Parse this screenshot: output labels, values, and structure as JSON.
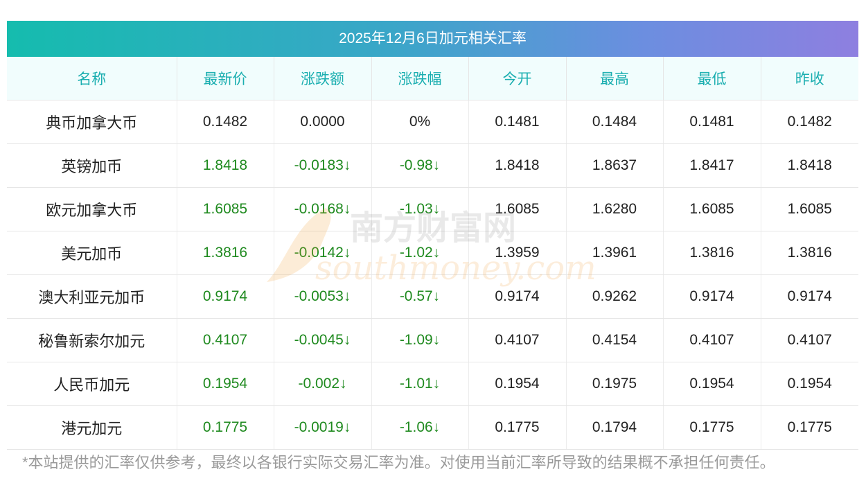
{
  "title": "2025年12月6日加元相关汇率",
  "columns": [
    "名称",
    "最新价",
    "涨跌额",
    "涨跌幅",
    "今开",
    "最高",
    "最低",
    "昨收"
  ],
  "rows": [
    {
      "name": "典币加拿大币",
      "latest": "0.1482",
      "change": "0.0000",
      "pct": "0%",
      "open": "0.1481",
      "high": "0.1484",
      "low": "0.1481",
      "prev": "0.1482",
      "down": false
    },
    {
      "name": "英镑加币",
      "latest": "1.8418",
      "change": "-0.0183↓",
      "pct": "-0.98↓",
      "open": "1.8418",
      "high": "1.8637",
      "low": "1.8417",
      "prev": "1.8418",
      "down": true
    },
    {
      "name": "欧元加拿大币",
      "latest": "1.6085",
      "change": "-0.0168↓",
      "pct": "-1.03↓",
      "open": "1.6085",
      "high": "1.6280",
      "low": "1.6085",
      "prev": "1.6085",
      "down": true
    },
    {
      "name": "美元加币",
      "latest": "1.3816",
      "change": "-0.0142↓",
      "pct": "-1.02↓",
      "open": "1.3959",
      "high": "1.3961",
      "low": "1.3816",
      "prev": "1.3816",
      "down": true
    },
    {
      "name": "澳大利亚元加币",
      "latest": "0.9174",
      "change": "-0.0053↓",
      "pct": "-0.57↓",
      "open": "0.9174",
      "high": "0.9262",
      "low": "0.9174",
      "prev": "0.9174",
      "down": true
    },
    {
      "name": "秘鲁新索尔加元",
      "latest": "0.4107",
      "change": "-0.0045↓",
      "pct": "-1.09↓",
      "open": "0.4107",
      "high": "0.4154",
      "low": "0.4107",
      "prev": "0.4107",
      "down": true
    },
    {
      "name": "人民币加元",
      "latest": "0.1954",
      "change": "-0.002↓",
      "pct": "-1.01↓",
      "open": "0.1954",
      "high": "0.1975",
      "low": "0.1954",
      "prev": "0.1954",
      "down": true
    },
    {
      "name": "港元加元",
      "latest": "0.1775",
      "change": "-0.0019↓",
      "pct": "-1.06↓",
      "open": "0.1775",
      "high": "0.1794",
      "low": "0.1775",
      "prev": "0.1775",
      "down": true
    }
  ],
  "watermark": {
    "cn": "南方财富网",
    "en": "southmoney.com"
  },
  "note": "*本站提供的汇率仅供参考，最终以各银行实际交易汇率为准。对使用当前汇率所导致的结果概不承担任何责任。",
  "colors": {
    "header_text": "#1aaeb0",
    "down": "#1f8a1f",
    "banner_start": "#15bcae",
    "banner_end": "#8e7fe0"
  }
}
